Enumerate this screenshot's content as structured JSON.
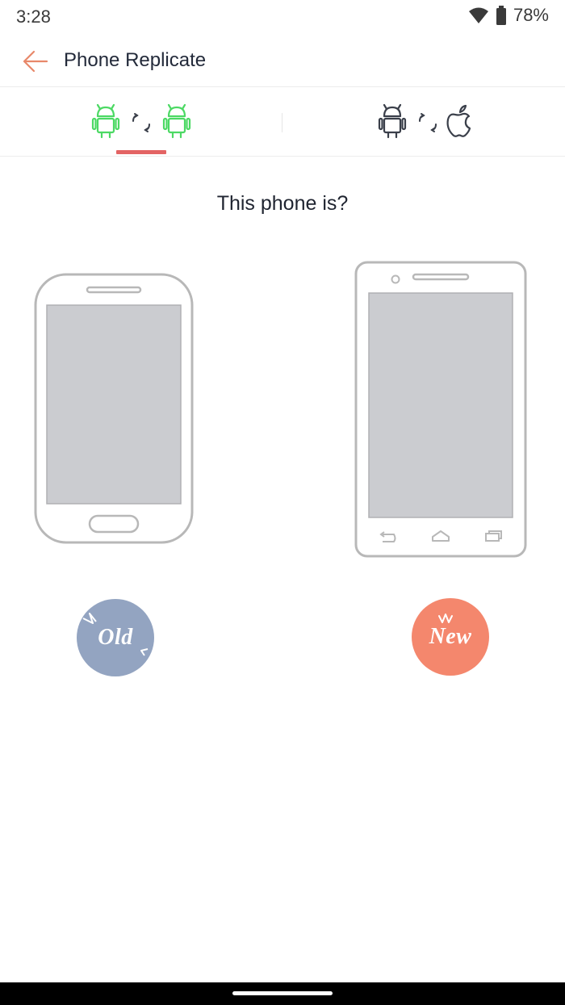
{
  "status_bar": {
    "time": "3:28",
    "battery_percent": "78%",
    "icons": [
      "wifi-icon",
      "battery-icon"
    ]
  },
  "app_bar": {
    "title": "Phone Replicate",
    "back_icon": "arrow-left-icon"
  },
  "tabs": {
    "selected": "android-to-android",
    "items": [
      {
        "id": "android-to-android",
        "icons": [
          "android-icon",
          "sync-arrows-icon",
          "android-icon"
        ],
        "active": true
      },
      {
        "id": "android-to-iphone",
        "icons": [
          "android-icon",
          "sync-arrows-icon",
          "apple-icon"
        ],
        "active": false
      }
    ]
  },
  "question": "This phone is?",
  "choices": {
    "old": {
      "label": "Old",
      "color": "#93a4c1"
    },
    "new": {
      "label": "New",
      "color": "#f4876d"
    }
  },
  "colors": {
    "accent": "#e36464",
    "android_active": "#4cd964",
    "icon_inactive": "#3a3f4a",
    "phone_outline": "#b8b8b8",
    "screen_fill": "#cbccd0"
  }
}
